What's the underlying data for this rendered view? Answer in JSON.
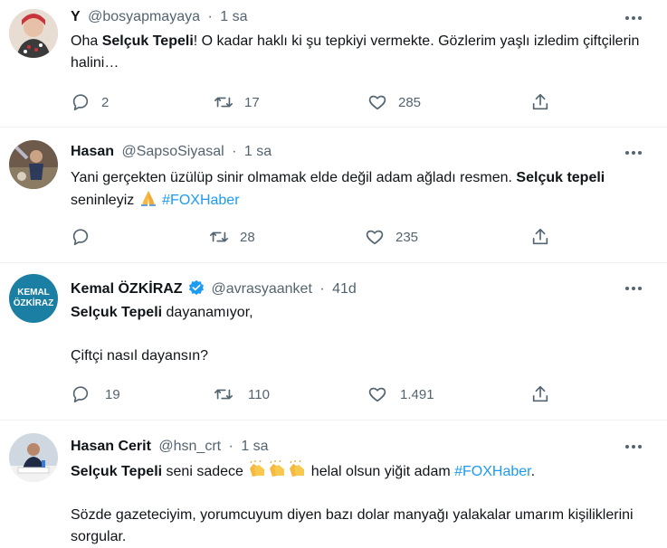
{
  "tweets": [
    {
      "name": "Y",
      "handle": "@bosyapmayaya",
      "dot": "·",
      "time": "1 sa",
      "text_pre": "Oha ",
      "text_bold": "Selçuk Tepeli",
      "text_post": "! O kadar haklı ki şu tepkiyi vermekte. Gözlerim yaşlı izledim çiftçilerin halini…",
      "replies": "2",
      "retweets": "17",
      "likes": "285"
    },
    {
      "name": "Hasan",
      "handle": "@SapsoSiyasal",
      "dot": "·",
      "time": "1 sa",
      "text_pre": "Yani gerçekten üzülüp sinir olmamak elde değil adam ağladı resmen. ",
      "text_bold": "Selçuk tepeli",
      "text_post": " seninleyiz ",
      "hashtag": "#FOXHaber",
      "replies": "",
      "retweets": "28",
      "likes": "235"
    },
    {
      "name": "Kemal ÖZKİRAZ",
      "handle": "@avrasyaanket",
      "dot": "·",
      "time": "41d",
      "avatar_line1": "KEMAL",
      "avatar_line2": "ÖZKİRAZ",
      "line1_bold": "Selçuk Tepeli",
      "line1_post": " dayanamıyor,",
      "line2": "Çiftçi nasıl dayansın?",
      "replies": "19",
      "retweets": "110",
      "likes": "1.491"
    },
    {
      "name": "Hasan Cerit",
      "handle": "@hsn_crt",
      "dot": "·",
      "time": "1 sa",
      "line1_bold": "Selçuk Tepeli",
      "line1_mid": " seni sadece ",
      "line1_post": " helal olsun yiğit adam ",
      "hashtag": "#FOXHaber",
      "hashtag_end": ".",
      "line2": "Sözde gazeteciyim, yorumcuyum diyen bazı dolar manyağı yalakalar umarım kişiliklerini sorgular."
    }
  ],
  "icons": {
    "more": "more-icon",
    "reply": "reply-icon",
    "retweet": "retweet-icon",
    "like": "heart-icon",
    "share": "share-icon",
    "verified": "verified-icon",
    "pray": "folded-hands-icon",
    "clap": "clapping-hands-icon"
  },
  "colors": {
    "text": "#0f1419",
    "secondary": "#536471",
    "link": "#1d9bf0",
    "divider": "#eff3f4",
    "verified": "#1d9bf0",
    "kemal_avatar_bg": "#1b7ea3"
  }
}
